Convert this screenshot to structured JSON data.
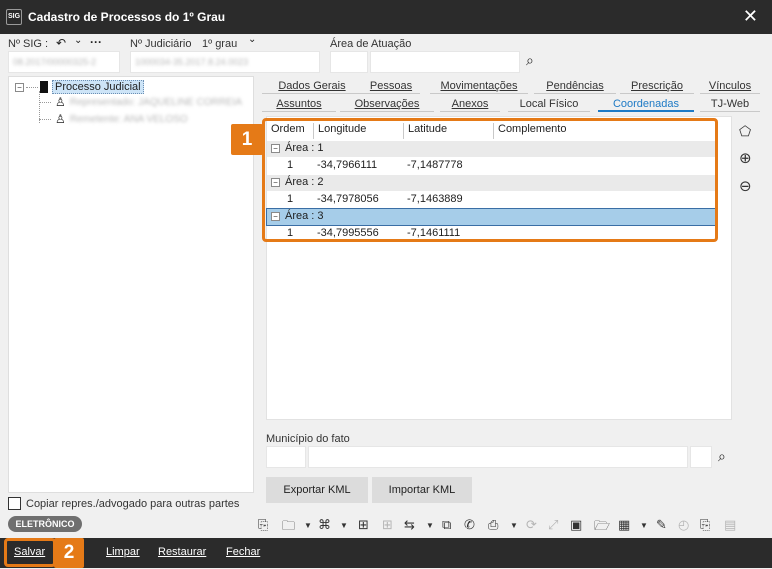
{
  "window": {
    "title": "Cadastro de Processos do 1º Grau",
    "app_icon": "SIG"
  },
  "header": {
    "sig_label": "Nº SIG :",
    "sig_value": "08.2017/00000325-2",
    "judiciario_label": "Nº Judiciário",
    "grau_label": "1º grau",
    "judiciario_value": "1000034-35.2017.8.24.0023",
    "area_label": "Área de Atuação"
  },
  "tree": {
    "root": "Processo Judicial",
    "children": [
      "Representado: JAQUELINE CORREIA",
      "Remetente: ANA VELOSO"
    ]
  },
  "tabs": {
    "row1": [
      "Dados Gerais",
      "Pessoas",
      "Movimentações",
      "Pendências",
      "Prescrição",
      "Vínculos"
    ],
    "row2": [
      "Assuntos",
      "Observações",
      "Anexos",
      "Local Físico",
      "Coordenadas",
      "TJ-Web"
    ],
    "active": "Coordenadas"
  },
  "grid": {
    "columns": [
      "Ordem",
      "Longitude",
      "Latitude",
      "Complemento"
    ],
    "groups": [
      {
        "label": "Área : 1",
        "ordem": "1",
        "longitude": "-34,7966111",
        "latitude": "-7,1487778"
      },
      {
        "label": "Área : 2",
        "ordem": "1",
        "longitude": "-34,7978056",
        "latitude": "-7,1463889"
      },
      {
        "label": "Área : 3",
        "ordem": "1",
        "longitude": "-34,7995556",
        "latitude": "-7,1461111"
      }
    ]
  },
  "municipio_label": "Município do fato",
  "buttons": {
    "export_kml": "Exportar KML",
    "import_kml": "Importar KML"
  },
  "copy_checkbox": "Copiar repres./advogado para outras partes",
  "eletronico": "ELETRÔNICO",
  "callouts": {
    "one": "1",
    "two": "2"
  },
  "bottom": {
    "salvar": "Salvar",
    "limpar": "Limpar",
    "restaurar": "Restaurar",
    "fechar": "Fechar"
  },
  "colors": {
    "accent": "#e57a17",
    "titlebar": "#2b2b2b",
    "active_tab": "#1e7ac5",
    "selection": "#a6cde9"
  }
}
